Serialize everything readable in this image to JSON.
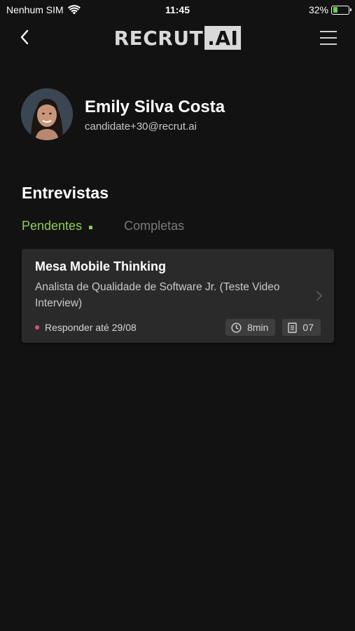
{
  "status_bar": {
    "carrier": "Nenhum SIM",
    "time": "11:45",
    "battery_percent": "32%",
    "battery_level": 0.32,
    "wifi_icon": "wifi-icon"
  },
  "nav": {
    "logo_text": "RECRUT",
    "logo_suffix": ".AI",
    "back_icon": "chevron-left-icon",
    "menu_icon": "hamburger-menu-icon"
  },
  "profile": {
    "name": "Emily Silva Costa",
    "email": "candidate+30@recrut.ai"
  },
  "interviews": {
    "title": "Entrevistas",
    "tabs": [
      {
        "label": "Pendentes",
        "active": true
      },
      {
        "label": "Completas",
        "active": false
      }
    ],
    "cards": [
      {
        "title": "Mesa Mobile Thinking",
        "subtitle": "Analista de Qualidade de Software Jr. (Teste Video Interview)",
        "deadline": "Responder até 29/08",
        "duration": "8min",
        "questions": "07"
      }
    ]
  },
  "colors": {
    "background": "#121212",
    "accent": "#8fcd57",
    "card": "#2a2a2a",
    "deadline_dot": "#e05070"
  }
}
